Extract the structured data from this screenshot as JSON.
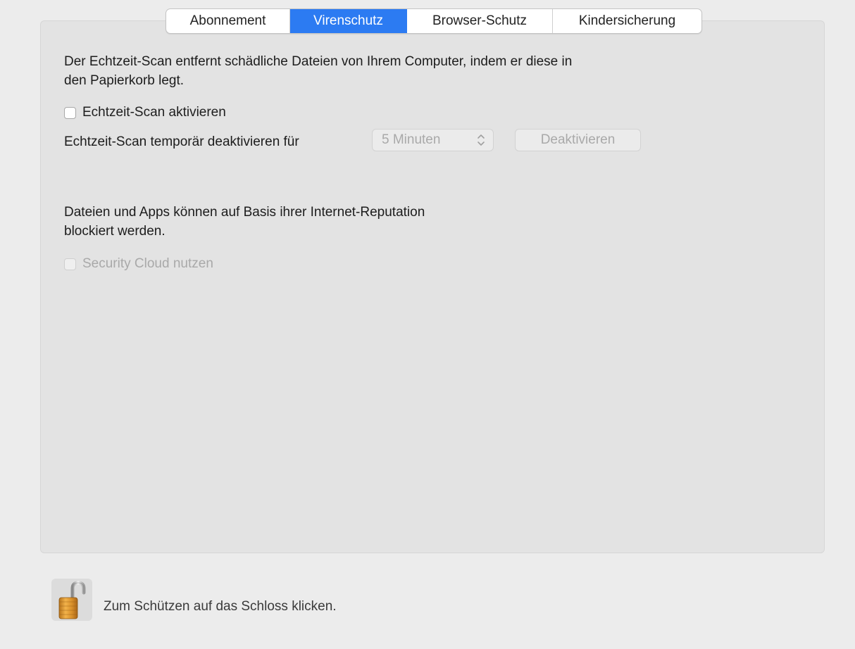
{
  "tabs": [
    {
      "label": "Abonnement",
      "active": false
    },
    {
      "label": "Virenschutz",
      "active": true
    },
    {
      "label": "Browser-Schutz",
      "active": false
    },
    {
      "label": "Kindersicherung",
      "active": false
    }
  ],
  "realtime": {
    "description_line1": "Der Echtzeit-Scan entfernt schädliche Dateien von Ihrem Computer, indem er diese in",
    "description_line2": "den Papierkorb legt.",
    "enable_label": "Echtzeit-Scan aktivieren",
    "enable_checked": false,
    "temp_disable_label": "Echtzeit-Scan temporär deaktivieren für",
    "duration_value": "5 Minuten",
    "deactivate_button": "Deaktivieren"
  },
  "reputation": {
    "description_line1": "Dateien und Apps können auf Basis ihrer Internet-Reputation",
    "description_line2": "blockiert werden.",
    "security_cloud_label": "Security Cloud nutzen",
    "security_cloud_checked": false
  },
  "footer": {
    "lock_icon": "unlocked-padlock-icon",
    "lock_text": "Zum Schützen auf das Schloss klicken."
  },
  "colors": {
    "accent": "#2c7bf2",
    "panel_bg": "#e3e3e3",
    "window_bg": "#ececec",
    "disabled_text": "#a9a9a9"
  }
}
